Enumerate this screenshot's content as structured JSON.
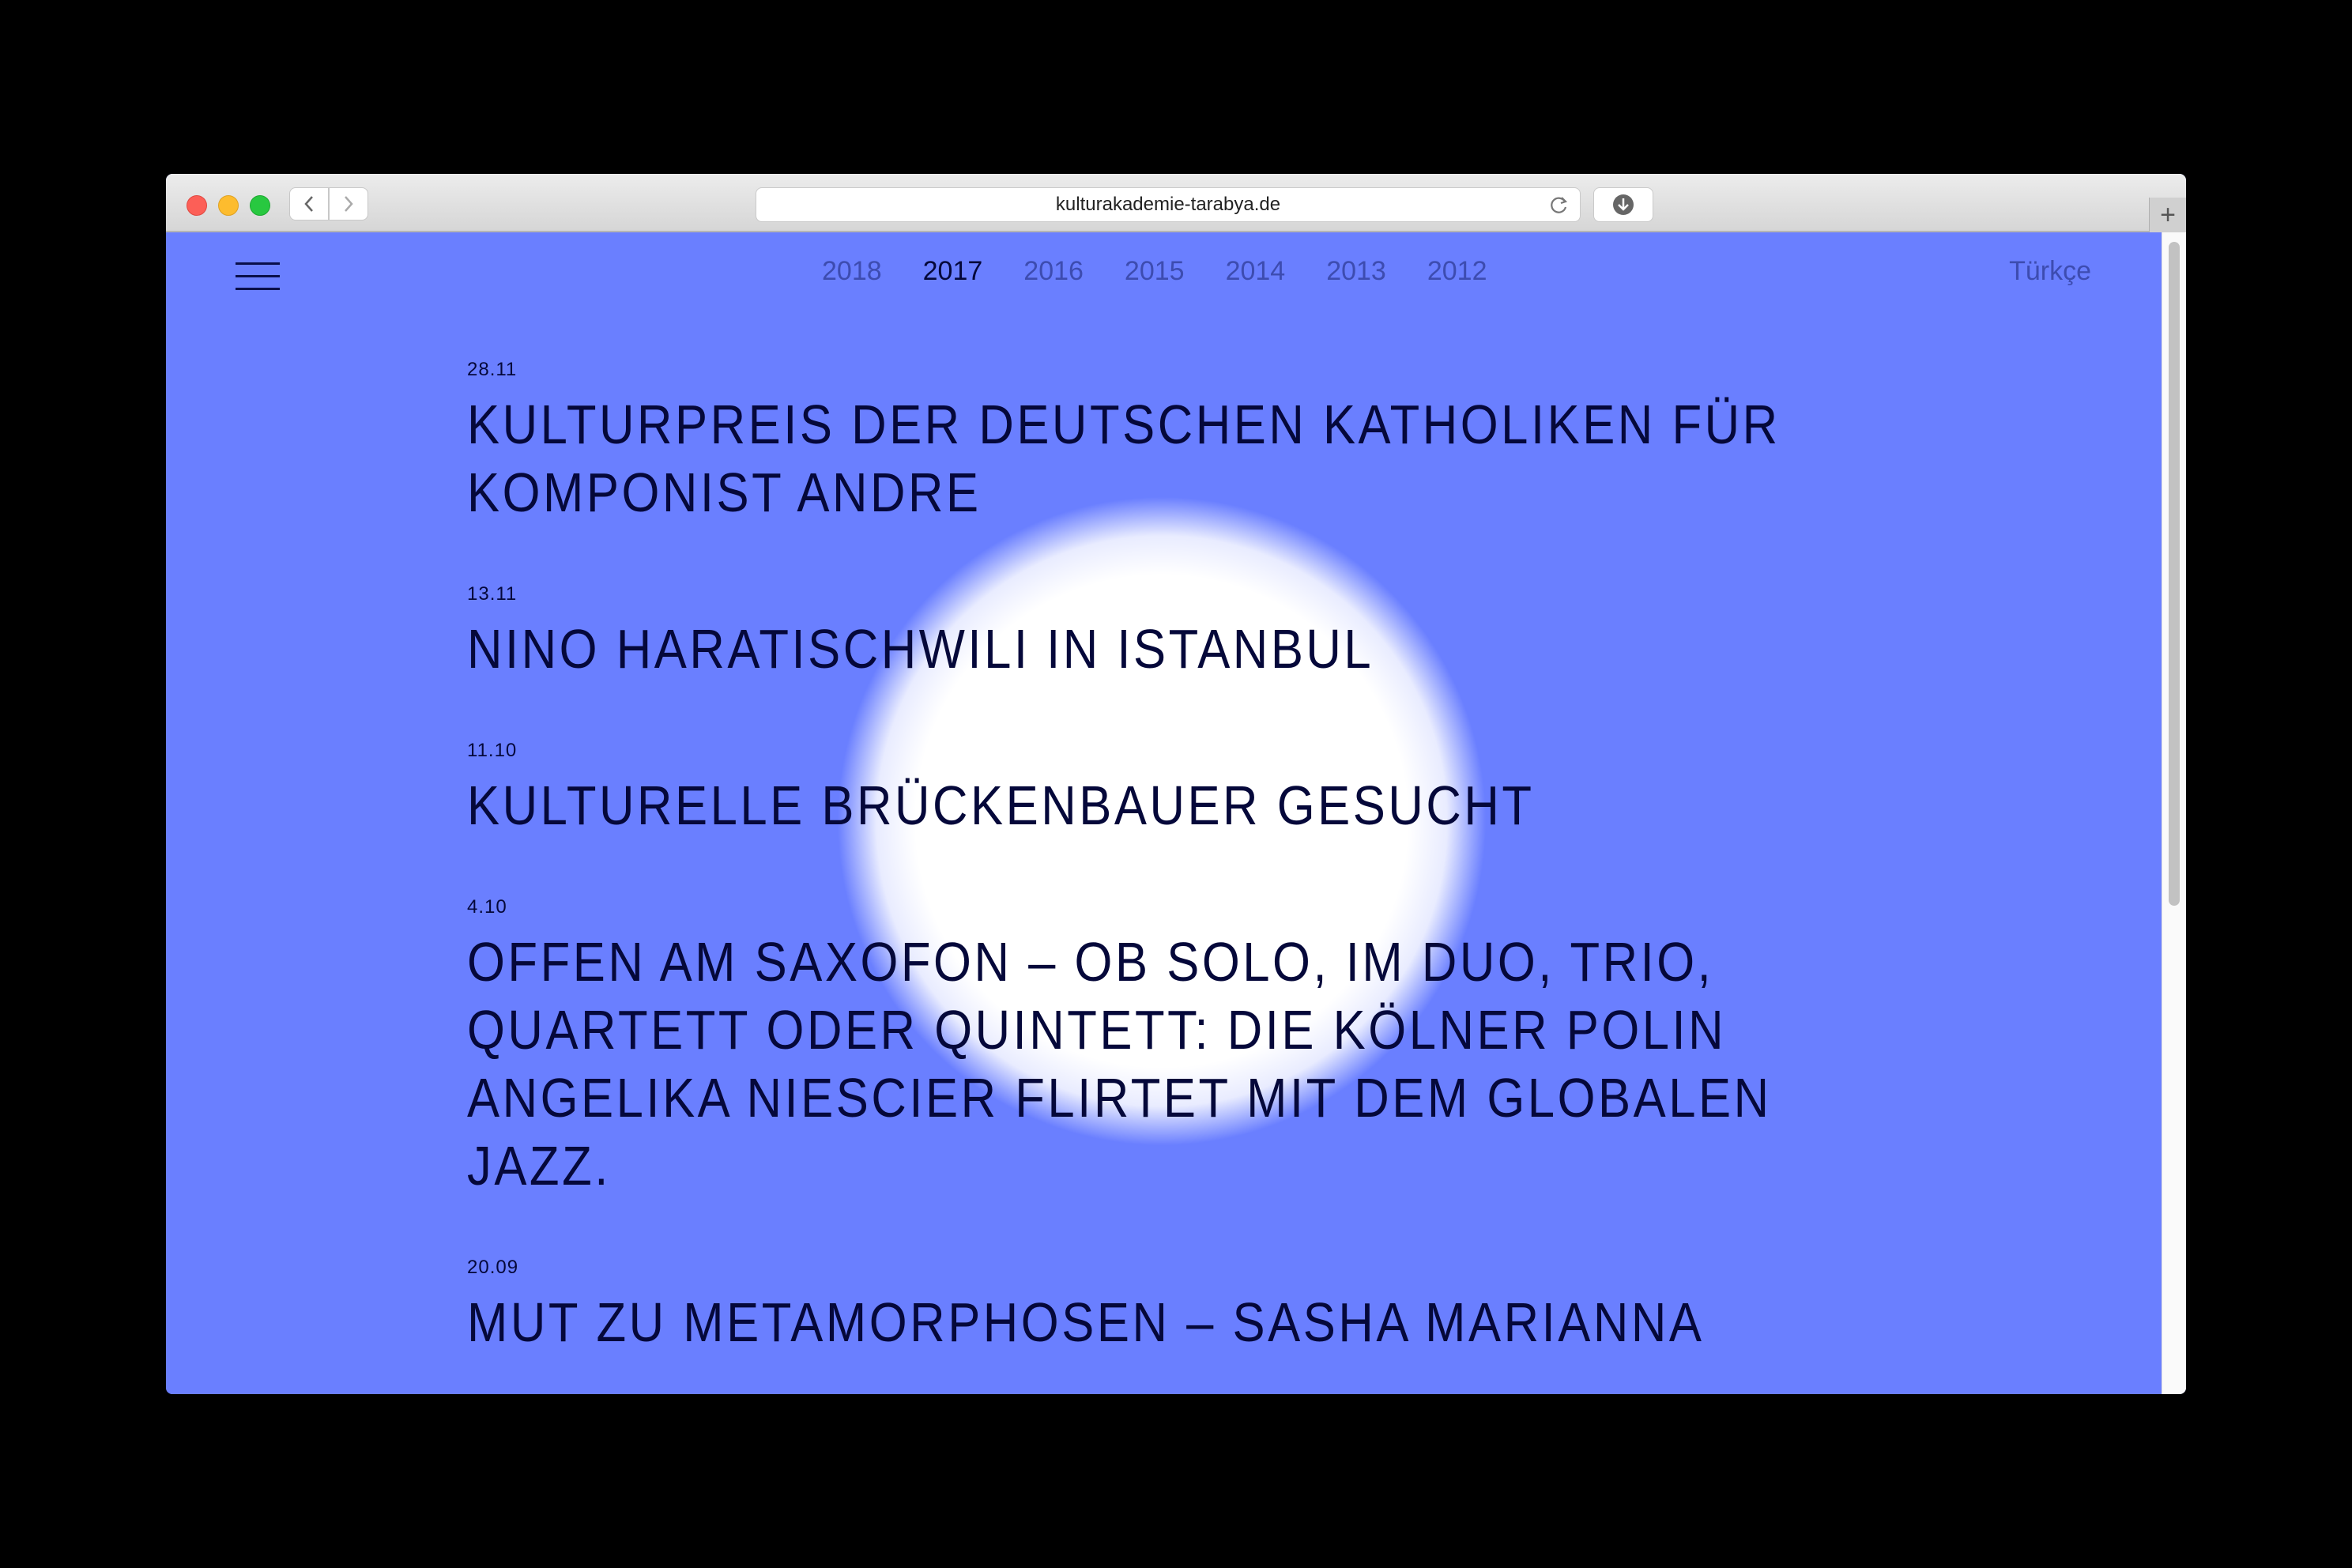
{
  "browser": {
    "url": "kulturakademie-tarabya.de",
    "new_tab_symbol": "+"
  },
  "nav": {
    "years": [
      "2018",
      "2017",
      "2016",
      "2015",
      "2014",
      "2013",
      "2012"
    ],
    "active_year": "2017",
    "language": "Türkçe"
  },
  "entries": [
    {
      "date": "28.11",
      "title": "Kulturpreis der deutschen Katholiken für Komponist Andre"
    },
    {
      "date": "13.11",
      "title": "Nino Haratischwili in Istanbul"
    },
    {
      "date": "11.10",
      "title": "Kulturelle Brückenbauer gesucht"
    },
    {
      "date": "4.10",
      "title": "Offen am Saxofon – ob solo, im Duo, Trio, Quartett oder Quintett: Die Kölner Polin Angelika Niescier flirtet mit dem globalen Jazz."
    },
    {
      "date": "20.09",
      "title": "Mut zu Metamorphosen – Sasha Marianna"
    }
  ],
  "colors": {
    "background": "#6a7fff",
    "text": "#05083a",
    "inactive": "#3d4cb0"
  },
  "icons": [
    "menu-icon",
    "back-arrow-icon",
    "forward-arrow-icon",
    "reload-icon",
    "download-icon",
    "plus-icon"
  ]
}
